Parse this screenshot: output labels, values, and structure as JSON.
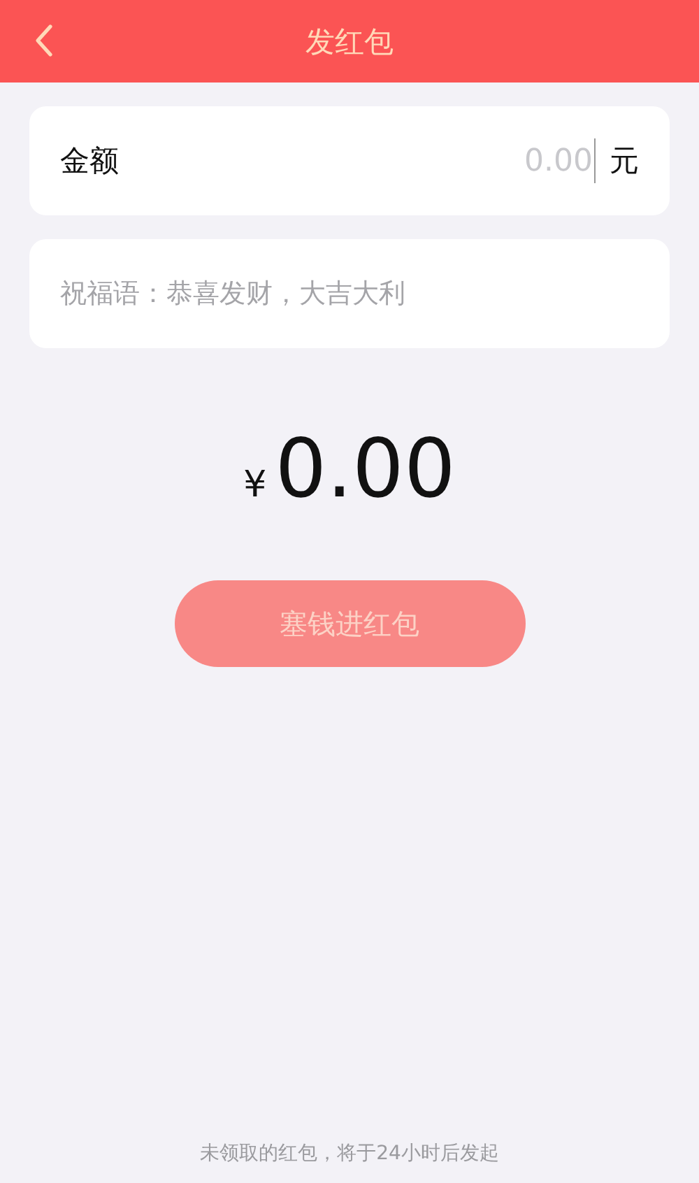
{
  "header": {
    "title": "发红包"
  },
  "amount": {
    "label": "金额",
    "placeholder": "0.00",
    "unit": "元"
  },
  "greeting": {
    "placeholder": "祝福语：恭喜发财，大吉大利"
  },
  "total": {
    "currency": "¥",
    "value": "0.00"
  },
  "submit": {
    "label": "塞钱进红包",
    "disabled": true
  },
  "footer_note": "未领取的红包，将于24小时后发起"
}
